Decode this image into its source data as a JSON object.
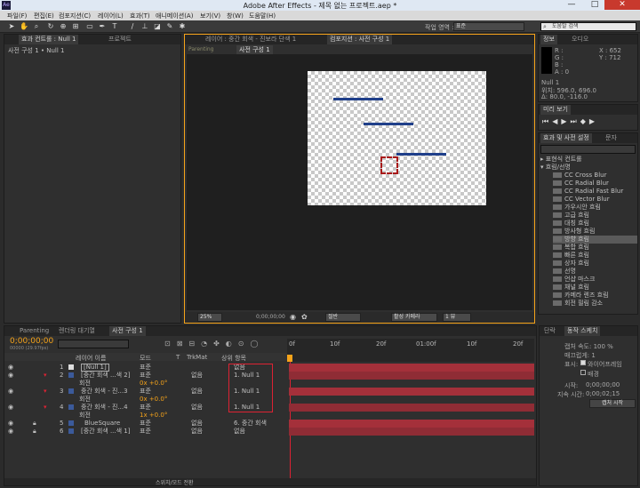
{
  "app": {
    "title": "Adobe After Effects - 제목 없는 프로젝트.aep *",
    "icon_text": "Ae"
  },
  "window_controls": {
    "minimize": "—",
    "maximize": "□",
    "close": "✕"
  },
  "menu": [
    "파일(F)",
    "편집(E)",
    "컴포지션(C)",
    "레이어(L)",
    "효과(T)",
    "애니메이션(A)",
    "보기(V)",
    "창(W)",
    "도움말(H)"
  ],
  "toolbar": {
    "workspace_label": "작업 영역 :",
    "workspace_value": "표준",
    "search_placeholder": "도움말 검색"
  },
  "left_panel": {
    "tabs": [
      "효과 컨트롤 : Null 1",
      "프로젝트"
    ],
    "subtitle": "사전 구성 1 • Null 1"
  },
  "comp_panel": {
    "tabs": [
      "레이어 : 중간 회색 - 진보라 단색 1",
      "컴포지션 : 사전 구성 1"
    ],
    "breadcrumbs": [
      "Parenting",
      "사전 구성 1"
    ],
    "bottom": {
      "zoom": "25%",
      "timecode": "0;00;00;00",
      "resolution": "절반",
      "camera": "활성 카메라",
      "views": "1 뷰"
    }
  },
  "info_panel": {
    "tabs": [
      "정보",
      "오디오"
    ],
    "r_label": "R :",
    "g_label": "G :",
    "b_label": "B :",
    "a_label": "A : 0",
    "x_value": "X : 652",
    "y_value": "Y : 712",
    "layer_name": "Null 1",
    "position": "위치: 596.0, 696.0",
    "delta": "Δ: 80.0, -116.0"
  },
  "preview_panel": {
    "tab": "미리 보기"
  },
  "effects_panel": {
    "tabs": [
      "효과 및 사전 설정",
      "문자"
    ],
    "groups": [
      "▸ 표현식 컨트롤",
      "▾ 흐림/선명"
    ],
    "items": [
      "CC Cross Blur",
      "CC Radial Blur",
      "CC Radial Fast Blur",
      "CC Vector Blur",
      "가우시안 흐림",
      "고급 흐림",
      "대칭 흐림",
      "방사형 흐림",
      "방향 흐림",
      "복합 흐림",
      "빠른 흐림",
      "상자 흐림",
      "선명",
      "언샵 마스크",
      "채널 흐림",
      "카메라 렌즈 흐림",
      "회전 필림 감소"
    ]
  },
  "timeline": {
    "tabs": [
      "Parenting",
      "렌더링 대기열",
      "사전 구성 1"
    ],
    "timecode": "0;00;00;00",
    "fps": "00000 (29.97fps)",
    "columns": [
      "레이어 이름",
      "모드",
      "T",
      "TrkMat",
      "상위 항목"
    ],
    "ruler": [
      "0f",
      "10f",
      "20f",
      "01:00f",
      "10f",
      "20f"
    ],
    "layers": [
      {
        "num": "1",
        "name": "[Null 1]",
        "color": "#cccccc",
        "mode": "표준",
        "trk": "",
        "parent": "없음"
      },
      {
        "num": "2",
        "name": "[중간 회색 ...색 2]",
        "color": "#3b5a9a",
        "mode": "표준",
        "trk": "없음",
        "parent": "1. Null 1"
      },
      {
        "num": "",
        "name": "회전",
        "value": "0x +0.0°"
      },
      {
        "num": "3",
        "name": "중간 회색 - 진...3",
        "color": "#3b5a9a",
        "mode": "표준",
        "trk": "없음",
        "parent": "1. Null 1"
      },
      {
        "num": "",
        "name": "회전",
        "value": "0x +0.0°"
      },
      {
        "num": "4",
        "name": "중간 회색 - 진...4",
        "color": "#3b5a9a",
        "mode": "표준",
        "trk": "없음",
        "parent": "1. Null 1"
      },
      {
        "num": "",
        "name": "회전",
        "value": "1x +0.0°"
      },
      {
        "num": "5",
        "name": "BlueSquare",
        "color": "#3b5a9a",
        "mode": "표준",
        "trk": "없음",
        "parent": "6. 중간 회색"
      },
      {
        "num": "6",
        "name": "[중간 회색 ...색 1]",
        "color": "#3b5a9a",
        "mode": "표준",
        "trk": "없음",
        "parent": "없음"
      }
    ],
    "bottom_toggle": "스위치/모드 전환"
  },
  "tracker_panel": {
    "tabs": [
      "단락",
      "동작 스케치"
    ],
    "capture_speed": "캡처 속도: 100 %",
    "smoothing": "매끄럽게: 1",
    "show_label": "표시:",
    "wireframe": "와이어프레임",
    "background": "배경",
    "start_label": "시작:",
    "start_value": "0;00;00;00",
    "duration_label": "지속 시간:",
    "duration_value": "0;00;02;15",
    "capture_button": "캡처 시작"
  },
  "colors": {
    "accent": "#f5a31a",
    "layer_bar": "#a4303a",
    "highlight_box": "#d22"
  }
}
